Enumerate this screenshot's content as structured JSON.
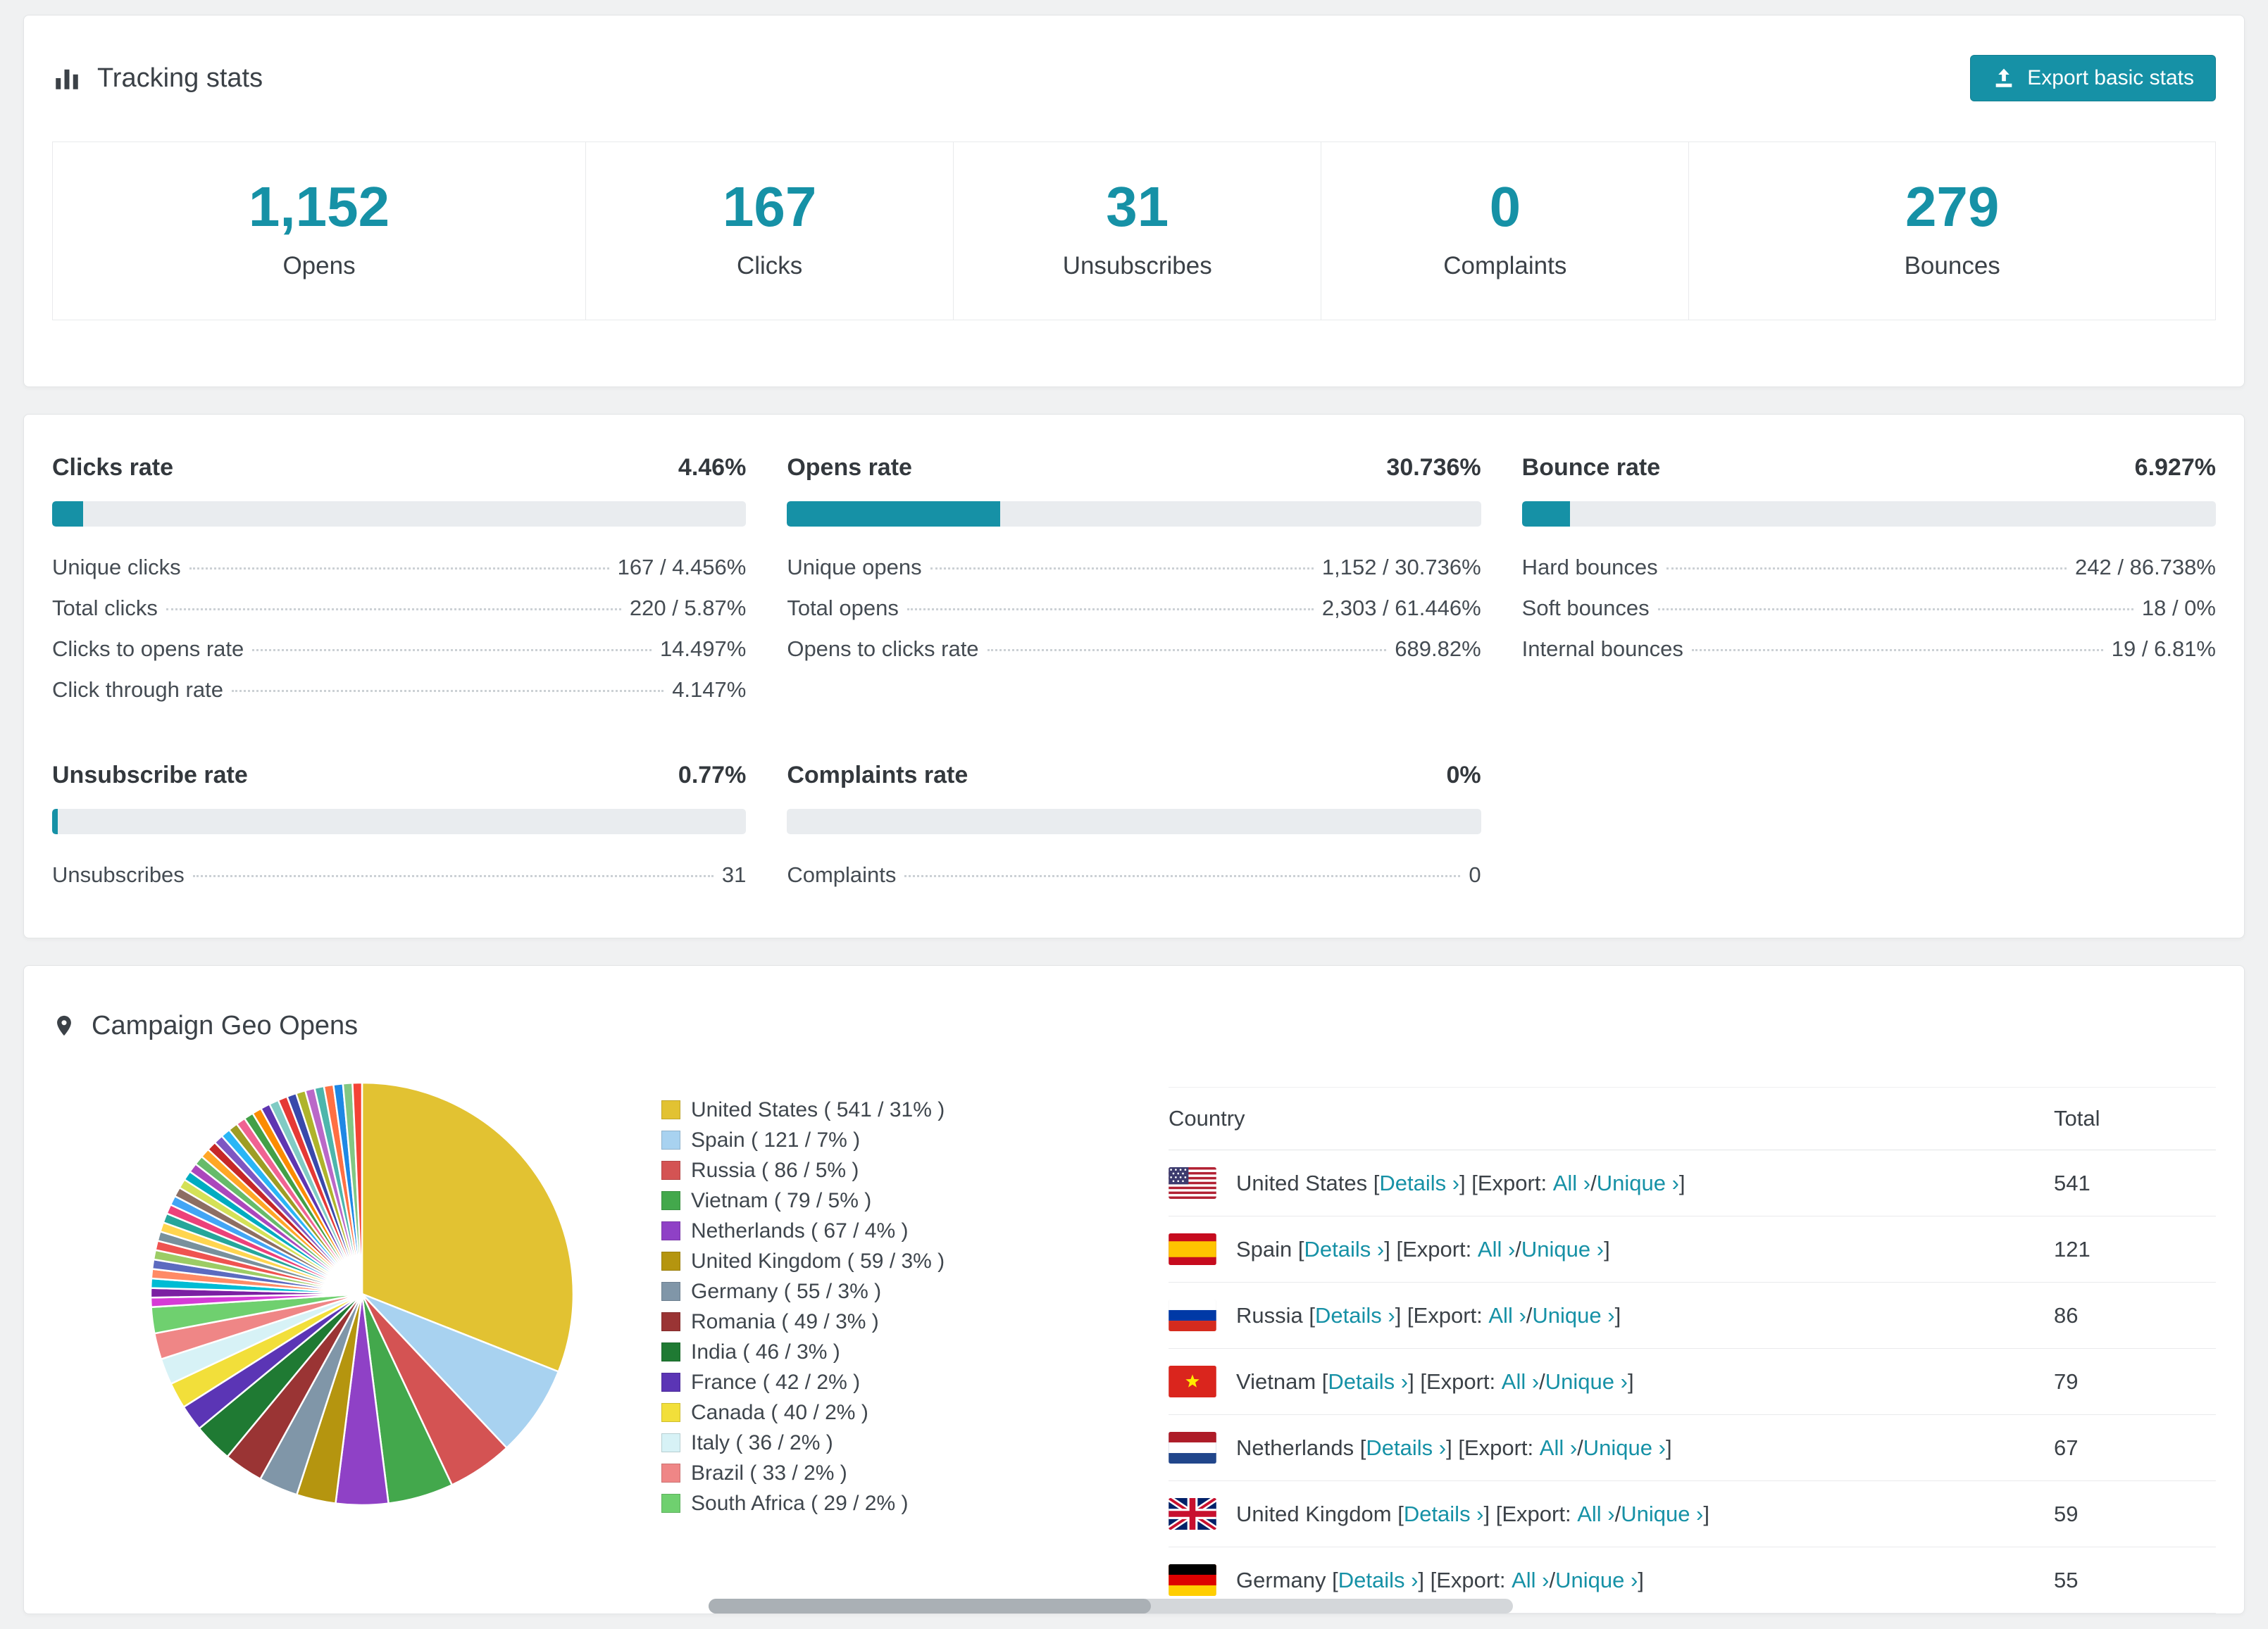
{
  "colors": {
    "accent": "#1691a6",
    "bar_track": "#e9ecef"
  },
  "tracking": {
    "title": "Tracking stats",
    "export_button": "Export basic stats",
    "stats": [
      {
        "value": "1,152",
        "label": "Opens"
      },
      {
        "value": "167",
        "label": "Clicks"
      },
      {
        "value": "31",
        "label": "Unsubscribes"
      },
      {
        "value": "0",
        "label": "Complaints"
      },
      {
        "value": "279",
        "label": "Bounces"
      }
    ]
  },
  "rates": [
    {
      "title": "Clicks rate",
      "value": "4.46%",
      "percent": 4.46,
      "rows": [
        {
          "label": "Unique clicks",
          "value": "167 / 4.456%"
        },
        {
          "label": "Total clicks",
          "value": "220 / 5.87%"
        },
        {
          "label": "Clicks to opens rate",
          "value": "14.497%"
        },
        {
          "label": "Click through rate",
          "value": "4.147%"
        }
      ]
    },
    {
      "title": "Opens rate",
      "value": "30.736%",
      "percent": 30.736,
      "rows": [
        {
          "label": "Unique opens",
          "value": "1,152 / 30.736%"
        },
        {
          "label": "Total opens",
          "value": "2,303 / 61.446%"
        },
        {
          "label": "Opens to clicks rate",
          "value": "689.82%"
        }
      ]
    },
    {
      "title": "Bounce rate",
      "value": "6.927%",
      "percent": 6.927,
      "rows": [
        {
          "label": "Hard bounces",
          "value": "242 / 86.738%"
        },
        {
          "label": "Soft bounces",
          "value": "18 / 0%"
        },
        {
          "label": "Internal bounces",
          "value": "19 / 6.81%"
        }
      ]
    },
    {
      "title": "Unsubscribe rate",
      "value": "0.77%",
      "percent": 0.77,
      "rows": [
        {
          "label": "Unsubscribes",
          "value": "31"
        }
      ]
    },
    {
      "title": "Complaints rate",
      "value": "0%",
      "percent": 0,
      "rows": [
        {
          "label": "Complaints",
          "value": "0"
        }
      ]
    }
  ],
  "geo": {
    "title": "Campaign Geo Opens",
    "table": {
      "headers": {
        "country": "Country",
        "total": "Total"
      },
      "link_labels": {
        "details": "Details ›",
        "export": "Export:",
        "all": "All ›",
        "unique": "Unique ›",
        "slash": "/"
      },
      "rows": [
        {
          "country": "United States",
          "flag": "us",
          "total": "541"
        },
        {
          "country": "Spain",
          "flag": "es",
          "total": "121"
        },
        {
          "country": "Russia",
          "flag": "ru",
          "total": "86"
        },
        {
          "country": "Vietnam",
          "flag": "vn",
          "total": "79"
        },
        {
          "country": "Netherlands",
          "flag": "nl",
          "total": "67"
        },
        {
          "country": "United Kingdom",
          "flag": "gb",
          "total": "59"
        },
        {
          "country": "Germany",
          "flag": "de",
          "total": "55"
        }
      ]
    }
  },
  "chart_data": {
    "type": "pie",
    "title": "Campaign Geo Opens",
    "start_angle_deg": 0,
    "direction": "clockwise",
    "slices": [
      {
        "label": "United States",
        "value": 541,
        "percent": 31,
        "color": "#e2c232"
      },
      {
        "label": "Spain",
        "value": 121,
        "percent": 7,
        "color": "#a8d2f0"
      },
      {
        "label": "Russia",
        "value": 86,
        "percent": 5,
        "color": "#d45353"
      },
      {
        "label": "Vietnam",
        "value": 79,
        "percent": 5,
        "color": "#43a84c"
      },
      {
        "label": "Netherlands",
        "value": 67,
        "percent": 4,
        "color": "#8f41c6"
      },
      {
        "label": "United Kingdom",
        "value": 59,
        "percent": 3,
        "color": "#b5950f"
      },
      {
        "label": "Germany",
        "value": 55,
        "percent": 3,
        "color": "#8096a8"
      },
      {
        "label": "Romania",
        "value": 49,
        "percent": 3,
        "color": "#9a3434"
      },
      {
        "label": "India",
        "value": 46,
        "percent": 3,
        "color": "#1f7a33"
      },
      {
        "label": "France",
        "value": 42,
        "percent": 2,
        "color": "#5b35b5"
      },
      {
        "label": "Canada",
        "value": 40,
        "percent": 2,
        "color": "#f2df3a"
      },
      {
        "label": "Italy",
        "value": 36,
        "percent": 2,
        "color": "#d7f2f6"
      },
      {
        "label": "Brazil",
        "value": 33,
        "percent": 2,
        "color": "#ef8686"
      },
      {
        "label": "South Africa",
        "value": 29,
        "percent": 2,
        "color": "#6fd06f"
      }
    ],
    "others_percent": 26,
    "others_colors": [
      "#d63bd6",
      "#7b1fa2",
      "#00bcd4",
      "#ff8a65",
      "#5c6bc0",
      "#9ccc65",
      "#ef5350",
      "#78909c",
      "#ffd54f",
      "#26a69a",
      "#ec407a",
      "#42a5f5",
      "#8d6e63",
      "#d4e157",
      "#00acc1",
      "#ab47bc",
      "#66bb6a",
      "#ffa726",
      "#c62828",
      "#7e57c2",
      "#29b6f6",
      "#9e9d24",
      "#f06292",
      "#43a047",
      "#fb8c00",
      "#5e35b1",
      "#80cbc4",
      "#e53935",
      "#3949ab",
      "#afb42b",
      "#ba68c8",
      "#4db6ac",
      "#ff7043",
      "#1e88e5",
      "#81c784",
      "#f44336"
    ]
  }
}
